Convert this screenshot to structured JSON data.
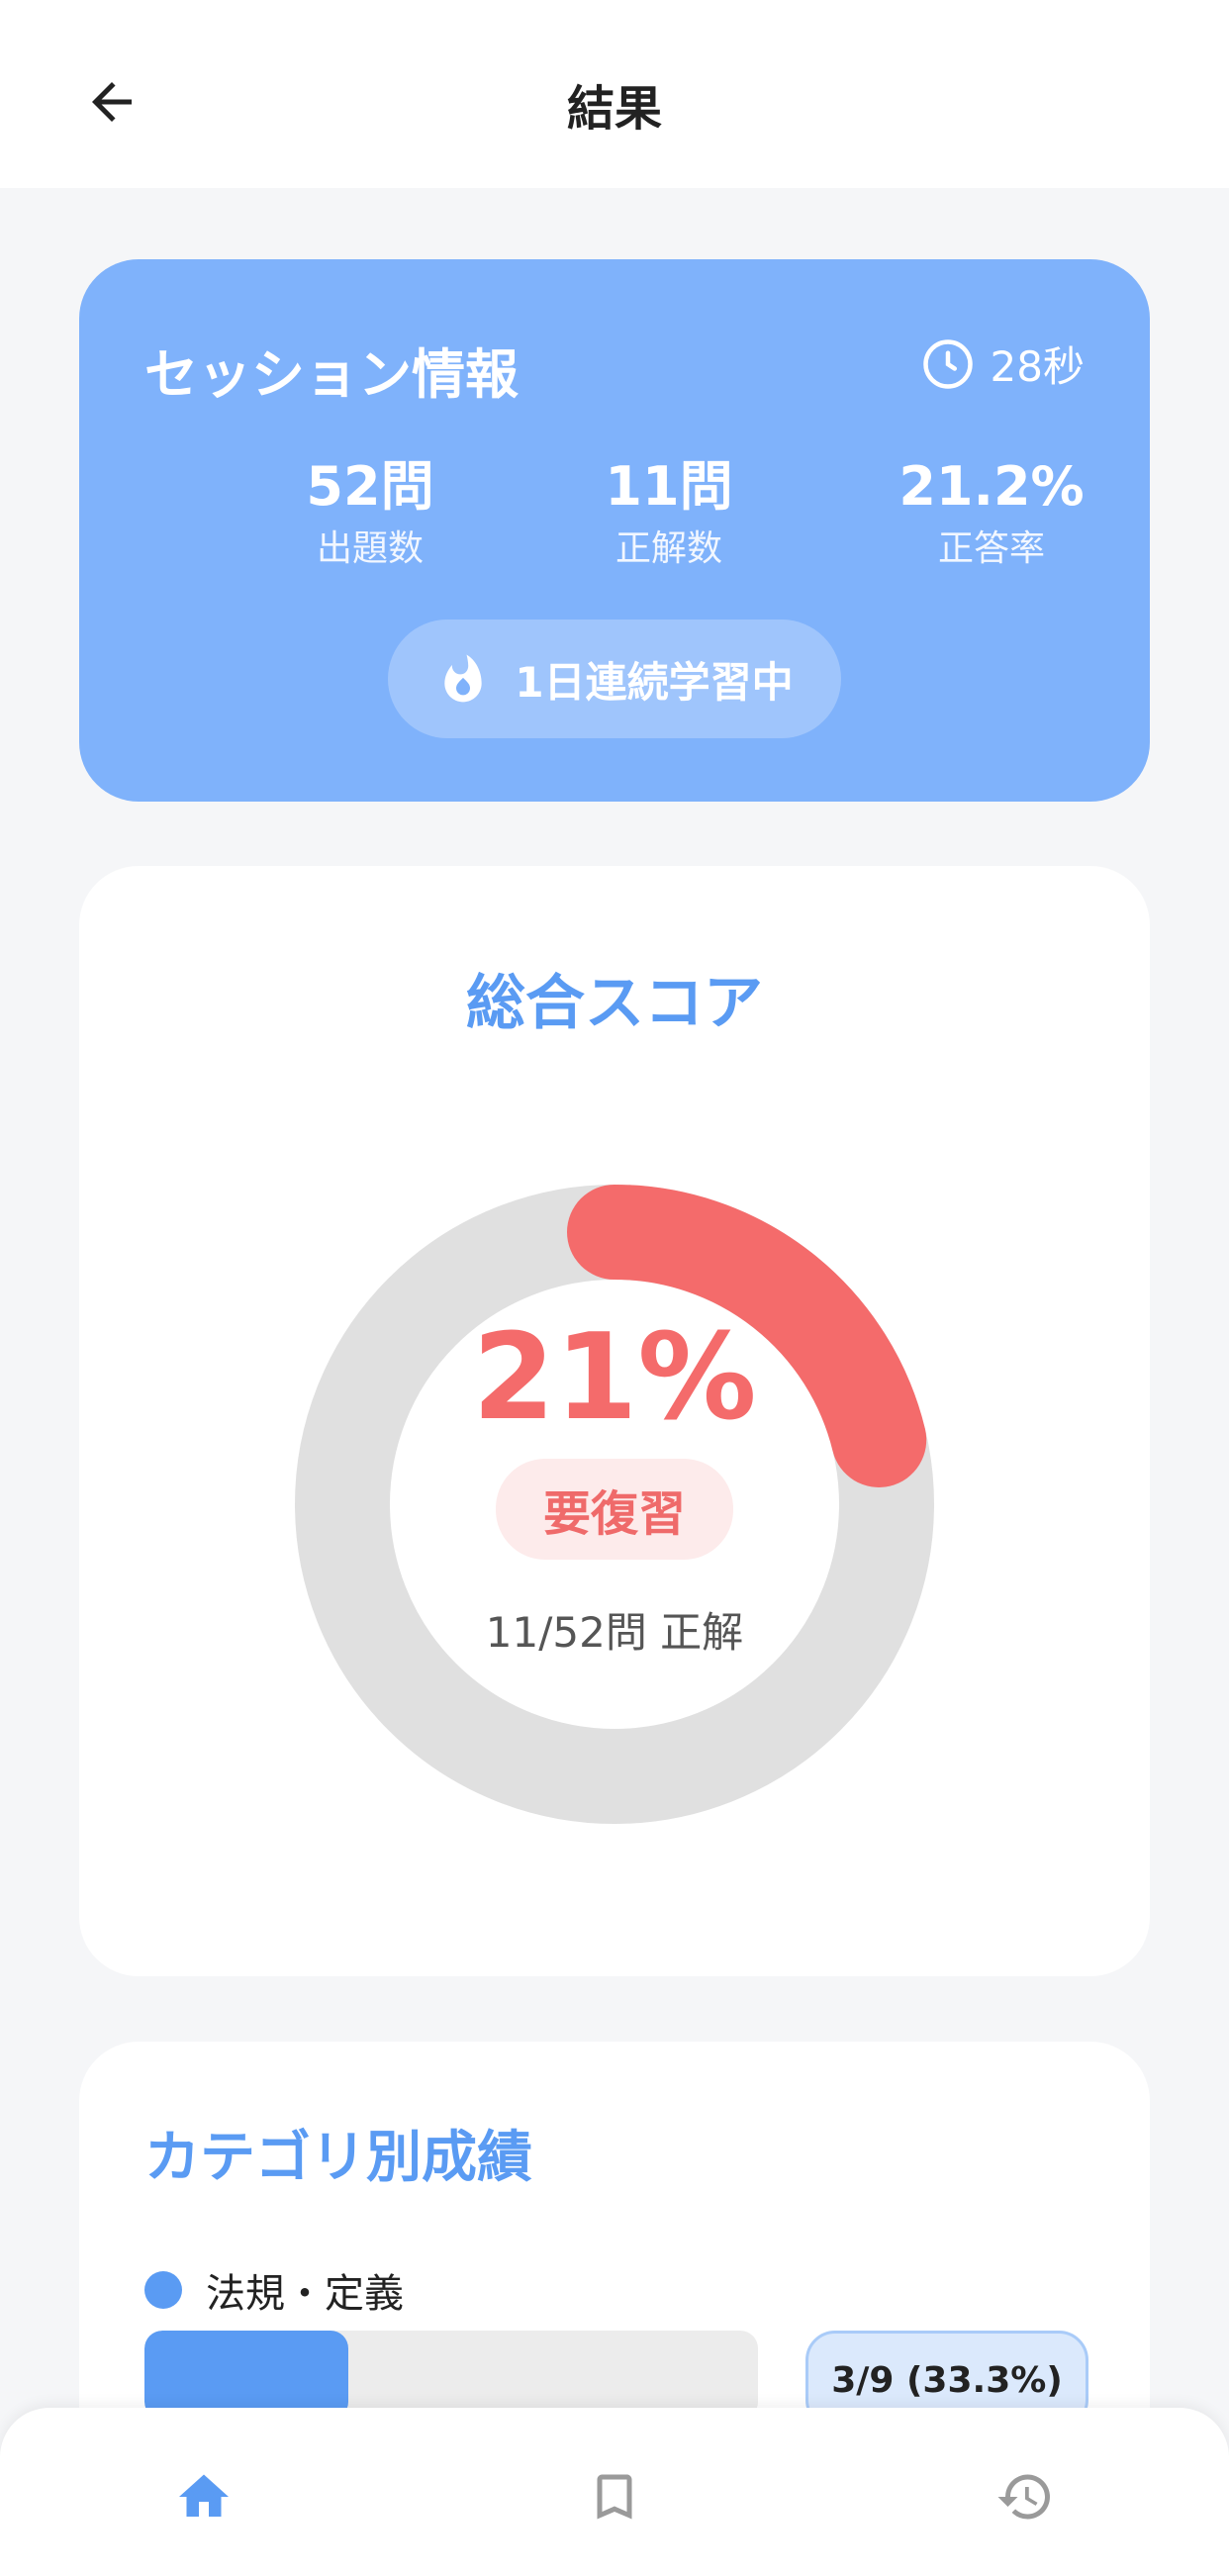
{
  "header": {
    "title": "結果"
  },
  "session": {
    "title": "セッション情報",
    "time": "28秒",
    "stats": [
      {
        "value": "52問",
        "label": "出題数"
      },
      {
        "value": "11問",
        "label": "正解数"
      },
      {
        "value": "21.2%",
        "label": "正答率"
      }
    ],
    "streak": "1日連続学習中"
  },
  "score": {
    "title": "総合スコア",
    "percent_label": "21%",
    "progress_fraction": 0.212,
    "badge": "要復習",
    "correct_text": "11/52問 正解"
  },
  "categories": {
    "title": "カテゴリ別成績",
    "items": [
      {
        "name": "法規・定義",
        "score": "3/9 (33.3%)",
        "fraction": 0.333
      }
    ]
  },
  "colors": {
    "primary": "#5a9bf3",
    "session_card": "#7fb2fb",
    "danger": "#f46b6b",
    "track": "#e0e0e0"
  },
  "nav": {
    "items": [
      {
        "icon": "home-icon",
        "active": true
      },
      {
        "icon": "bookmark-icon",
        "active": false
      },
      {
        "icon": "history-icon",
        "active": false
      }
    ]
  }
}
